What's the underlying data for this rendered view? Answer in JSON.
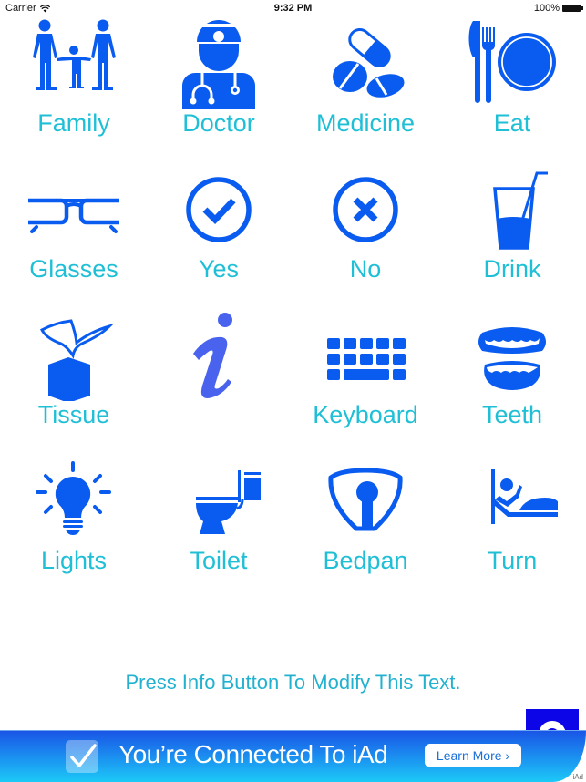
{
  "status_bar": {
    "carrier": "Carrier",
    "time": "9:32 PM",
    "battery": "100%"
  },
  "colors": {
    "icon": "#0a5cf0",
    "info_icon": "#4a63ee",
    "label": "#1fbfd6",
    "footer_text": "#22b2d0",
    "ad_gradient_top": "#1a56e6",
    "ad_gradient_bottom": "#1ccaf7"
  },
  "tiles": [
    {
      "label": "Family",
      "icon": "family-icon"
    },
    {
      "label": "Doctor",
      "icon": "doctor-icon"
    },
    {
      "label": "Medicine",
      "icon": "medicine-icon"
    },
    {
      "label": "Eat",
      "icon": "eat-icon"
    },
    {
      "label": "Glasses",
      "icon": "glasses-icon"
    },
    {
      "label": "Yes",
      "icon": "check-circle-icon"
    },
    {
      "label": "No",
      "icon": "x-circle-icon"
    },
    {
      "label": "Drink",
      "icon": "drink-icon"
    },
    {
      "label": "Tissue",
      "icon": "tissue-icon"
    },
    {
      "label": "",
      "icon": "info-icon"
    },
    {
      "label": "Keyboard",
      "icon": "keyboard-icon"
    },
    {
      "label": "Teeth",
      "icon": "teeth-icon"
    },
    {
      "label": "Lights",
      "icon": "lightbulb-icon"
    },
    {
      "label": "Toilet",
      "icon": "toilet-icon"
    },
    {
      "label": "Bedpan",
      "icon": "bedpan-icon"
    },
    {
      "label": "Turn",
      "icon": "bed-icon"
    }
  ],
  "footer": {
    "message": "Press Info Button To Modify This Text."
  },
  "ad": {
    "title": "You’re Connected To iAd",
    "button": "Learn More ›",
    "tag": "iAd"
  }
}
